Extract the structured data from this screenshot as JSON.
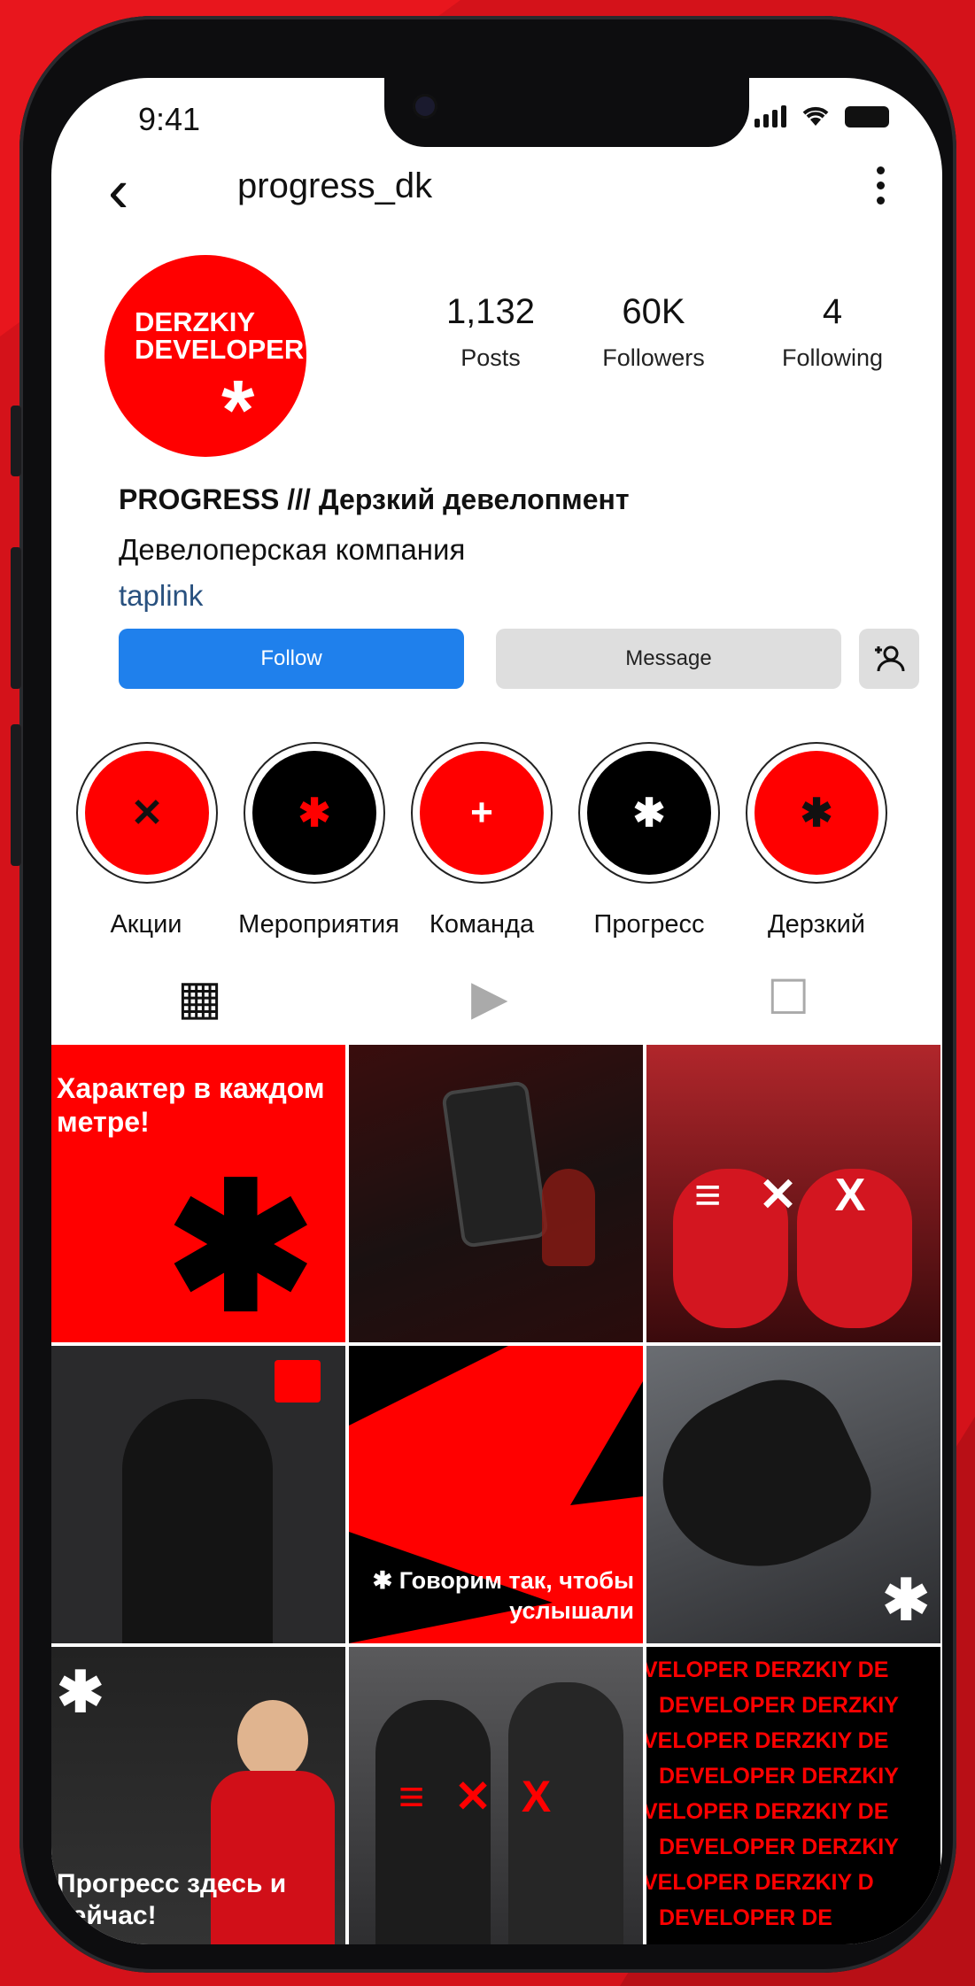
{
  "status": {
    "time": "9:41"
  },
  "header": {
    "username": "progress_dk",
    "back_icon": "chevron-left-icon",
    "menu_icon": "more-vertical-icon"
  },
  "profile": {
    "avatar_text": "DERZKIY DEVELOPER",
    "avatar_symbol": "*",
    "stats": [
      {
        "value": "1,132",
        "label": "Posts"
      },
      {
        "value": "60K",
        "label": "Followers"
      },
      {
        "value": "4",
        "label": "Following"
      }
    ],
    "name": "PROGRESS /// Дерзкий девелопмент",
    "category": "Девелоперская компания",
    "link": "taplink"
  },
  "buttons": {
    "follow": "Follow",
    "message": "Message",
    "add_user_icon": "add-person-icon"
  },
  "highlights": [
    {
      "label": "Акции",
      "bg": "#ff0000",
      "glyph": "✕"
    },
    {
      "label": "Мероприятия",
      "bg": "#000000",
      "glyph": "✱"
    },
    {
      "label": "Команда",
      "bg": "#ff0000",
      "glyph": "+"
    },
    {
      "label": "Прогресс",
      "bg": "#000000",
      "glyph": "✱"
    },
    {
      "label": "Дерзкий",
      "bg": "#ff0000",
      "glyph": "✱"
    }
  ],
  "tabs": [
    {
      "icon": "grid-icon",
      "glyph": "▦",
      "active": true
    },
    {
      "icon": "reels-icon",
      "glyph": "▶",
      "active": false
    },
    {
      "icon": "tagged-icon",
      "glyph": "☐",
      "active": false
    }
  ],
  "posts": {
    "post1": {
      "text": "Характер в каждом метре!",
      "symbol": "✱"
    },
    "post3": {
      "symbols": "≡ ✕ X"
    },
    "post5": {
      "text": "✱ Говорим так, чтобы услышали"
    },
    "post7": {
      "text": "Прогресс здесь и сейчас!",
      "symbol": "✱"
    },
    "post8": {
      "symbols": "≡ ✕ X"
    },
    "post9": {
      "lines": [
        "VELOPER DERZKIY DE",
        "DEVELOPER DERZKIY",
        "VELOPER DERZKIY DE",
        "DEVELOPER DERZKIY",
        "VELOPER DERZKIY DE",
        "DEVELOPER DERZKIY",
        "VELOPER DERZKIY D",
        "DEVELOPER DE"
      ]
    }
  },
  "colors": {
    "brand_red": "#ff0000",
    "follow_blue": "#1f80ec",
    "link": "#29517f"
  }
}
